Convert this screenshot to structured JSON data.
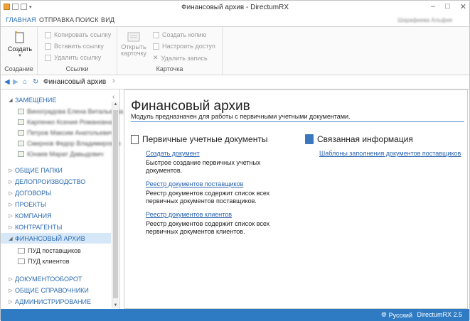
{
  "window": {
    "title": "Финансовый архив - DirectumRX",
    "user": "Шарафиева Альфия"
  },
  "menu": {
    "tabs": [
      "ГЛАВНАЯ",
      "ОТПРАВКА",
      "ПОИСК",
      "ВИД"
    ]
  },
  "ribbon": {
    "create_group": {
      "label": "Создание",
      "create_button": "Создать"
    },
    "links_group": {
      "label": "Ссылки",
      "copy_link": "Копировать ссылку",
      "paste_link": "Вставить ссылку",
      "delete_link": "Удалить ссылку"
    },
    "card_group": {
      "label": "Карточка",
      "open_card": "Открыть карточку",
      "create_copy": "Создать копию",
      "configure_access": "Настроить доступ",
      "delete_record": "Удалить запись"
    }
  },
  "navigation": {
    "breadcrumb": "Финансовый архив"
  },
  "sidebar": {
    "substitution": "ЗАМЕЩЕНИЕ",
    "substitutes": [
      "Виноградова Елена Витальевна",
      "Карпенко Ксения Романовна",
      "Петров Максим Анатольевич",
      "Смирнов Федор Владимирович",
      "Юнаев Марат Давыдович"
    ],
    "items": [
      "ОБЩИЕ ПАПКИ",
      "ДЕЛОПРОИЗВОДСТВО",
      "ДОГОВОРЫ",
      "ПРОЕКТЫ",
      "КОМПАНИЯ",
      "КОНТРАГЕНТЫ",
      "ФИНАНСОВЫЙ АРХИВ",
      "ДОКУМЕНТООБОРОТ",
      "ОБЩИЕ СПРАВОЧНИКИ",
      "АДМИНИСТРИРОВАНИЕ"
    ],
    "finarchive_children": [
      "ПУД поставщиков",
      "ПУД клиентов"
    ]
  },
  "main": {
    "title": "Финансовый архив",
    "description": "Модуль предназначен для работы с первичными учетными документами.",
    "primary": {
      "heading": "Первичные учетные документы",
      "links": [
        {
          "label": "Создать документ",
          "desc": "Быстрое создание первичных учетных документов."
        },
        {
          "label": "Реестр документов поставщиков",
          "desc": "Реестр документов содержит список всех первичных документов поставщиков."
        },
        {
          "label": "Реестр документов клиентов",
          "desc": "Реестр документов содержит список всех первичных документов клиентов."
        }
      ]
    },
    "related": {
      "heading": "Связанная информация",
      "links": [
        {
          "label": "Шаблоны заполнения документов поставщиков"
        }
      ]
    }
  },
  "status": {
    "language": "Русский",
    "version": "DirectumRX 2.5"
  },
  "colors": {
    "accent": "#2e7bc4",
    "link": "#2a63b0",
    "selected": "#d6e7f8"
  }
}
